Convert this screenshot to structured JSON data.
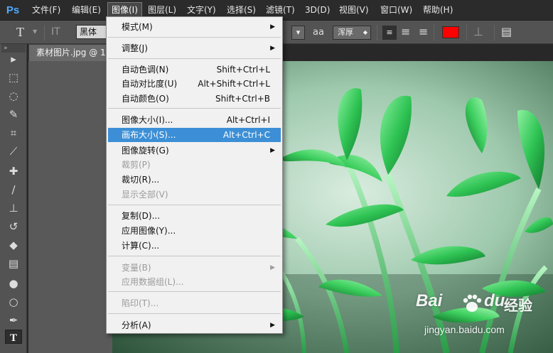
{
  "app": {
    "logo": "Ps"
  },
  "menubar": {
    "items": [
      {
        "label": "文件(F)"
      },
      {
        "label": "编辑(E)"
      },
      {
        "label": "图像(I)"
      },
      {
        "label": "图层(L)"
      },
      {
        "label": "文字(Y)"
      },
      {
        "label": "选择(S)"
      },
      {
        "label": "滤镜(T)"
      },
      {
        "label": "3D(D)"
      },
      {
        "label": "视图(V)"
      },
      {
        "label": "窗口(W)"
      },
      {
        "label": "帮助(H)"
      }
    ],
    "active_index": 2
  },
  "options": {
    "tool_glyph": "T",
    "orient_glyph": "IT",
    "font_family": "黑体",
    "aa_label": "aa",
    "antialias_value": "浑厚",
    "text_color": "#ff0000"
  },
  "toolbar": {
    "grip": "»",
    "tools": [
      {
        "name": "move-tool-icon",
        "glyph": "▸"
      },
      {
        "name": "marquee-tool-icon",
        "glyph": "⬚"
      },
      {
        "name": "lasso-tool-icon",
        "glyph": "◌"
      },
      {
        "name": "quick-select-tool-icon",
        "glyph": "✎"
      },
      {
        "name": "crop-tool-icon",
        "glyph": "⌗"
      },
      {
        "name": "eyedropper-tool-icon",
        "glyph": "⟋"
      },
      {
        "name": "healing-brush-tool-icon",
        "glyph": "✚"
      },
      {
        "name": "brush-tool-icon",
        "glyph": "∕"
      },
      {
        "name": "clone-stamp-tool-icon",
        "glyph": "⊥"
      },
      {
        "name": "history-brush-tool-icon",
        "glyph": "↺"
      },
      {
        "name": "eraser-tool-icon",
        "glyph": "◆"
      },
      {
        "name": "gradient-tool-icon",
        "glyph": "▤"
      },
      {
        "name": "blur-tool-icon",
        "glyph": "●"
      },
      {
        "name": "dodge-tool-icon",
        "glyph": "○"
      },
      {
        "name": "pen-tool-icon",
        "glyph": "✒"
      },
      {
        "name": "type-tool-icon",
        "glyph": "T"
      }
    ],
    "selected_index": 15
  },
  "document": {
    "tab_title": "素材图片.jpg @ 10"
  },
  "image_menu": {
    "items": [
      {
        "label": "模式(M)",
        "shortcut": "",
        "submenu": true,
        "disabled": false
      },
      {
        "label": "调整(J)",
        "shortcut": "",
        "submenu": true,
        "disabled": false
      },
      {
        "label": "自动色调(N)",
        "shortcut": "Shift+Ctrl+L",
        "submenu": false,
        "disabled": false
      },
      {
        "label": "自动对比度(U)",
        "shortcut": "Alt+Shift+Ctrl+L",
        "submenu": false,
        "disabled": false
      },
      {
        "label": "自动颜色(O)",
        "shortcut": "Shift+Ctrl+B",
        "submenu": false,
        "disabled": false
      },
      {
        "label": "图像大小(I)...",
        "shortcut": "Alt+Ctrl+I",
        "submenu": false,
        "disabled": false
      },
      {
        "label": "画布大小(S)...",
        "shortcut": "Alt+Ctrl+C",
        "submenu": false,
        "disabled": false
      },
      {
        "label": "图像旋转(G)",
        "shortcut": "",
        "submenu": true,
        "disabled": false
      },
      {
        "label": "裁剪(P)",
        "shortcut": "",
        "submenu": false,
        "disabled": true
      },
      {
        "label": "裁切(R)...",
        "shortcut": "",
        "submenu": false,
        "disabled": false
      },
      {
        "label": "显示全部(V)",
        "shortcut": "",
        "submenu": false,
        "disabled": true
      },
      {
        "label": "复制(D)...",
        "shortcut": "",
        "submenu": false,
        "disabled": false
      },
      {
        "label": "应用图像(Y)...",
        "shortcut": "",
        "submenu": false,
        "disabled": false
      },
      {
        "label": "计算(C)...",
        "shortcut": "",
        "submenu": false,
        "disabled": false
      },
      {
        "label": "变量(B)",
        "shortcut": "",
        "submenu": true,
        "disabled": true
      },
      {
        "label": "应用数据组(L)...",
        "shortcut": "",
        "submenu": false,
        "disabled": true
      },
      {
        "label": "陷印(T)...",
        "shortcut": "",
        "submenu": false,
        "disabled": true
      },
      {
        "label": "分析(A)",
        "shortcut": "",
        "submenu": true,
        "disabled": false
      }
    ],
    "highlighted_index": 6,
    "arrow_glyph": "▶"
  },
  "watermark": {
    "brand": "Bai",
    "brand2": "du",
    "cn": "经验",
    "url": "jingyan.baidu.com"
  },
  "colors": {
    "menubar_bg": "#2b2b2b",
    "panel_bg": "#535353",
    "highlight": "#3c8fd6",
    "foreground_color": "#ff0000"
  }
}
